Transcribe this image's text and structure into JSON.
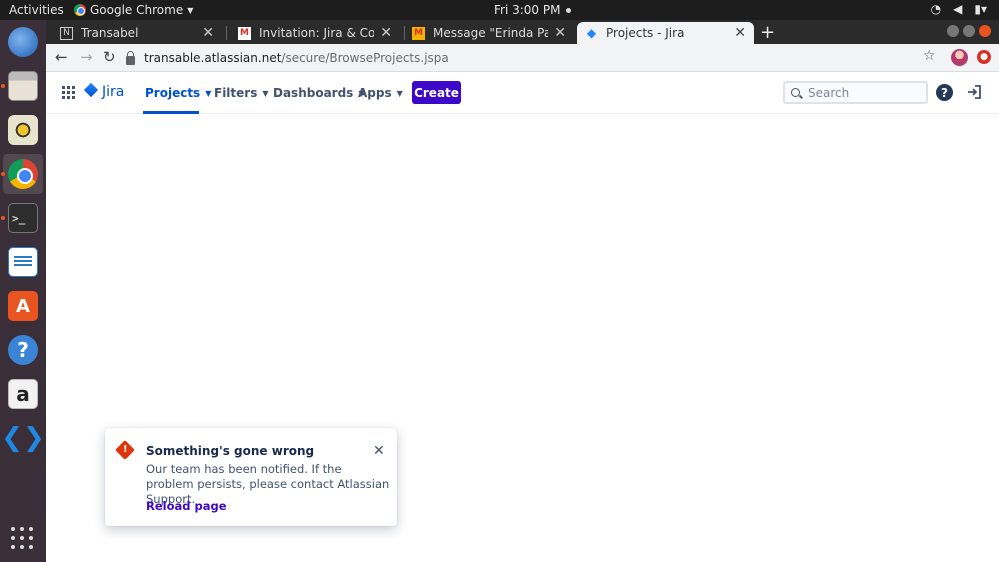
{
  "system_bar": {
    "activities": "Activities",
    "app_name": "Google Chrome",
    "clock": "Fri  3:00 PM"
  },
  "dock": {
    "items": [
      "thunderbird-icon",
      "files-icon",
      "rhythmbox-icon",
      "chrome-icon",
      "terminal-icon",
      "writer-icon",
      "software-icon",
      "help-icon",
      "amazon-icon",
      "vscode-icon"
    ]
  },
  "browser": {
    "tabs": [
      {
        "title": "Transabel"
      },
      {
        "title": "Invitation: Jira & Confluence"
      },
      {
        "title": "Message \"Erinda Pathak f"
      },
      {
        "title": "Projects - Jira"
      }
    ],
    "url_host": "transable.atlassian.net",
    "url_path": "/secure/BrowseProjects.jspa"
  },
  "jira": {
    "logo_text": "Jira",
    "nav": {
      "projects": "Projects",
      "filters": "Filters",
      "dashboards": "Dashboards",
      "apps": "Apps"
    },
    "create_label": "Create",
    "search_placeholder": "Search",
    "help_glyph": "?"
  },
  "flag": {
    "title": "Something's gone wrong",
    "body": "Our team has been notified. If the problem persists, please contact Atlassian Support.",
    "action": "Reload page"
  },
  "colors": {
    "accent": "#0052cc",
    "create_bg": "#3d07c9",
    "error": "#de350b"
  }
}
